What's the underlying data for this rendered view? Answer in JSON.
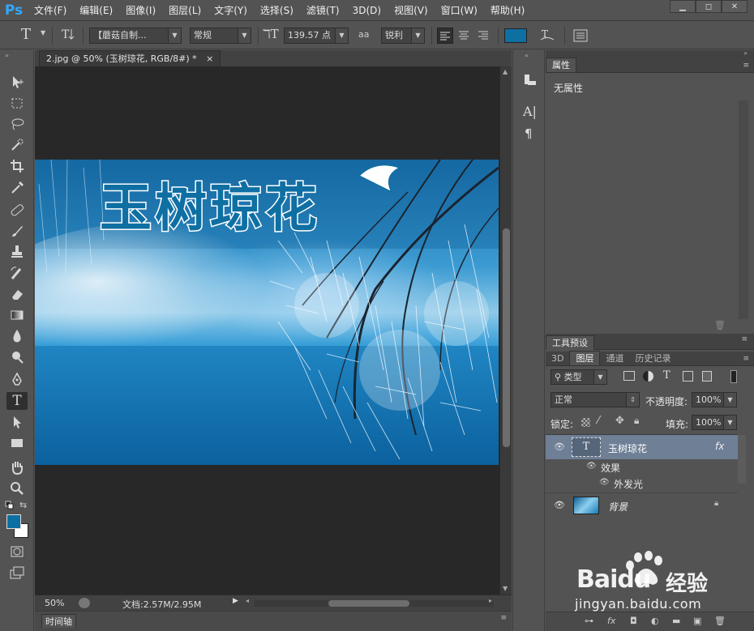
{
  "app": {
    "logo": "Ps"
  },
  "menu": [
    "文件(F)",
    "编辑(E)",
    "图像(I)",
    "图层(L)",
    "文字(Y)",
    "选择(S)",
    "滤镜(T)",
    "3D(D)",
    "视图(V)",
    "窗口(W)",
    "帮助(H)"
  ],
  "window_controls": {
    "minimize": "▁",
    "maximize": "◻",
    "close": "✕"
  },
  "options": {
    "tool_glyph": "T",
    "font_family": "【蘑菇自制...",
    "font_style": "常规",
    "font_size": "139.57 点",
    "aa_icon": "aa",
    "aa_mode": "锐利",
    "color_swatch": "#0e6fa3"
  },
  "document": {
    "tab_title": "2.jpg @ 50% (玉树琼花, RGB/8#) *",
    "tab_close": "×",
    "title_text": "玉树琼花"
  },
  "status": {
    "zoom": "50%",
    "doc_info": "文档:2.57M/2.95M"
  },
  "timeline": {
    "label": "时间轴"
  },
  "properties": {
    "tab": "属性",
    "empty_text": "无属性"
  },
  "tool_presets": {
    "tab": "工具预设"
  },
  "layers": {
    "tabs": [
      "3D",
      "图层",
      "通道",
      "历史记录"
    ],
    "filter_label": "类型",
    "blend_mode": "正常",
    "opacity_label": "不透明度:",
    "opacity_value": "100%",
    "lock_label": "锁定:",
    "fill_label": "填充:",
    "fill_value": "100%",
    "items": [
      {
        "name": "玉树琼花",
        "fx": "fx",
        "effects_label": "效果",
        "effect": "外发光"
      },
      {
        "name": "背景"
      }
    ]
  },
  "watermark": {
    "brand": "Baidu",
    "brand_cn": "经验",
    "url": "jingyan.baidu.com"
  },
  "colors": {
    "ui_bg": "#535353",
    "canvas_bg": "#282828",
    "accent": "#31a8ff",
    "fg_color": "#0e6fa3",
    "bg_color": "#ffffff"
  }
}
